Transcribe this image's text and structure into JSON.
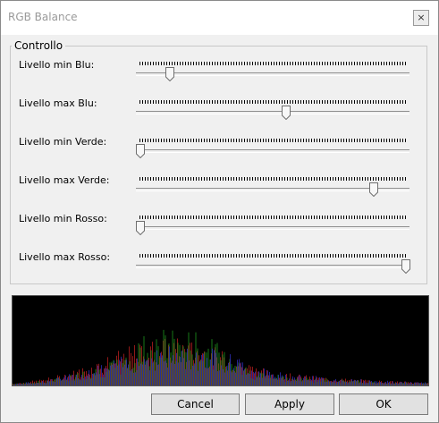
{
  "window": {
    "title": "RGB Balance",
    "close_glyph": "×"
  },
  "group": {
    "title": "Controllo"
  },
  "sliders": [
    {
      "label": "Livello min Blu:",
      "value": 0.11
    },
    {
      "label": "Livello max Blu:",
      "value": 0.55
    },
    {
      "label": "Livello min Verde:",
      "value": 0.0
    },
    {
      "label": "Livello max  Verde:",
      "value": 0.88
    },
    {
      "label": "Livello min Rosso:",
      "value": 0.0
    },
    {
      "label": "Livello max  Rosso:",
      "value": 1.0
    }
  ],
  "buttons": {
    "cancel": "Cancel",
    "apply": "Apply",
    "ok": "OK"
  },
  "colors": {
    "red": "#c02020",
    "green": "#20a020",
    "blue": "#3030c0",
    "background": "#000000"
  }
}
